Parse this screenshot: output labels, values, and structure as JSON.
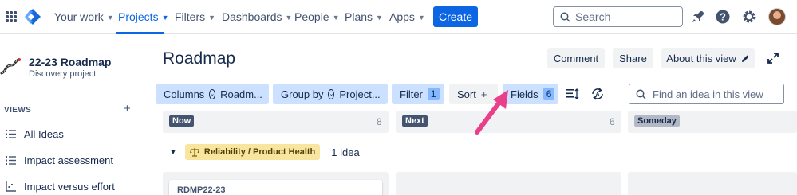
{
  "topnav": {
    "items": [
      {
        "label": "Your work"
      },
      {
        "label": "Projects"
      },
      {
        "label": "Filters"
      },
      {
        "label": "Dashboards"
      },
      {
        "label": "People"
      },
      {
        "label": "Plans"
      },
      {
        "label": "Apps"
      }
    ],
    "active_item": "Projects",
    "create_label": "Create",
    "search_placeholder": "Search"
  },
  "sidebar": {
    "project_name": "22-23 Roadmap",
    "project_type": "Discovery project",
    "views_label": "VIEWS",
    "views_add": "+",
    "views": [
      {
        "label": "All Ideas",
        "icon": "list-icon"
      },
      {
        "label": "Impact assessment",
        "icon": "list-icon"
      },
      {
        "label": "Impact versus effort",
        "icon": "matrix-icon"
      }
    ]
  },
  "main": {
    "title": "Roadmap",
    "buttons": {
      "comment": "Comment",
      "share": "Share",
      "about": "About this view"
    },
    "toolbar": {
      "columns_label": "Columns",
      "columns_value": "Roadm...",
      "groupby_label": "Group by",
      "groupby_value": "Project...",
      "filter_label": "Filter",
      "filter_count": "1",
      "sort_label": "Sort",
      "sort_add": "+",
      "fields_label": "Fields",
      "fields_count": "6",
      "search_placeholder": "Find an idea in this view"
    },
    "columns": [
      {
        "label": "Now",
        "count": "8",
        "badge_bg": "#44546f",
        "badge_fg": "#ffffff"
      },
      {
        "label": "Next",
        "count": "6",
        "badge_bg": "#44546f",
        "badge_fg": "#ffffff"
      },
      {
        "label": "Someday",
        "count": "",
        "badge_bg": "#b3b9c4",
        "badge_fg": "#172b4d"
      }
    ],
    "group": {
      "label": "Reliability / Product Health",
      "count": "1 idea",
      "icon": "scales-icon"
    },
    "card": {
      "key": "RDMP22-23"
    }
  },
  "colors": {
    "accent": "#0c66e4",
    "arrow": "#e8408a",
    "toolbar_active_bg": "#cce0ff",
    "group_lozenge": "#f8e6a0"
  }
}
